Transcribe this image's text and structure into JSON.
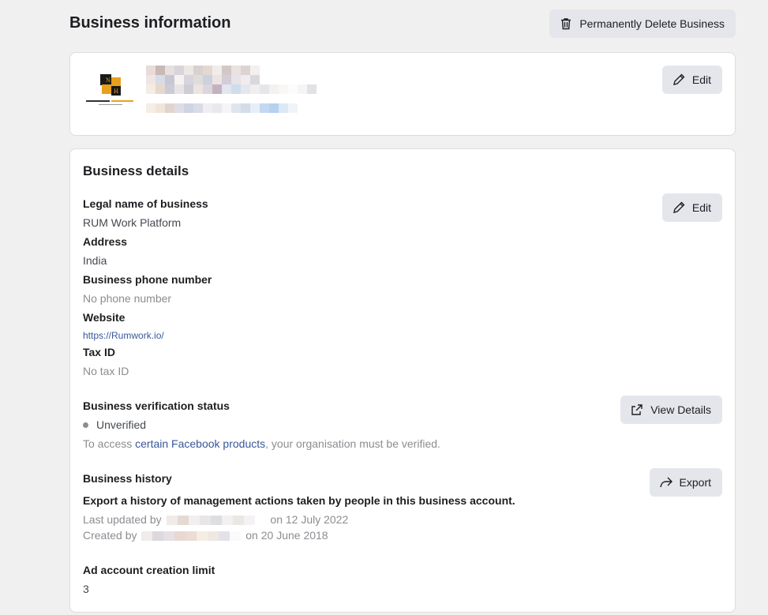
{
  "header": {
    "title": "Business information",
    "delete_button": "Permanently Delete Business"
  },
  "profile_card": {
    "edit_label": "Edit"
  },
  "details": {
    "title": "Business details",
    "edit_label": "Edit",
    "legal_name_label": "Legal name of business",
    "legal_name_value": "RUM Work Platform",
    "address_label": "Address",
    "address_value": "India",
    "phone_label": "Business phone number",
    "phone_value": "No phone number",
    "website_label": "Website",
    "website_value": "https://Rumwork.io/",
    "tax_label": "Tax ID",
    "tax_value": "No tax ID",
    "verification_label": "Business verification status",
    "verification_value": "Unverified",
    "verification_note_prefix": "To access ",
    "verification_note_link": "certain Facebook products",
    "verification_note_suffix": ", your organisation must be verified.",
    "view_details_label": "View Details",
    "history_label": "Business history",
    "history_description": "Export a history of management actions taken by people in this business account.",
    "last_updated_prefix": "Last updated by",
    "last_updated_suffix": "on 12 July 2022",
    "created_prefix": "Created by",
    "created_suffix": "on 20 June 2018",
    "export_label": "Export",
    "ad_limit_label": "Ad account creation limit",
    "ad_limit_value": "3"
  },
  "colors": {
    "link": "#385898",
    "button_bg": "#e4e6eb",
    "page_bg": "#f0f0f0"
  },
  "icons": [
    "trash-icon",
    "pencil-icon",
    "external-link-icon",
    "share-arrow-icon"
  ]
}
